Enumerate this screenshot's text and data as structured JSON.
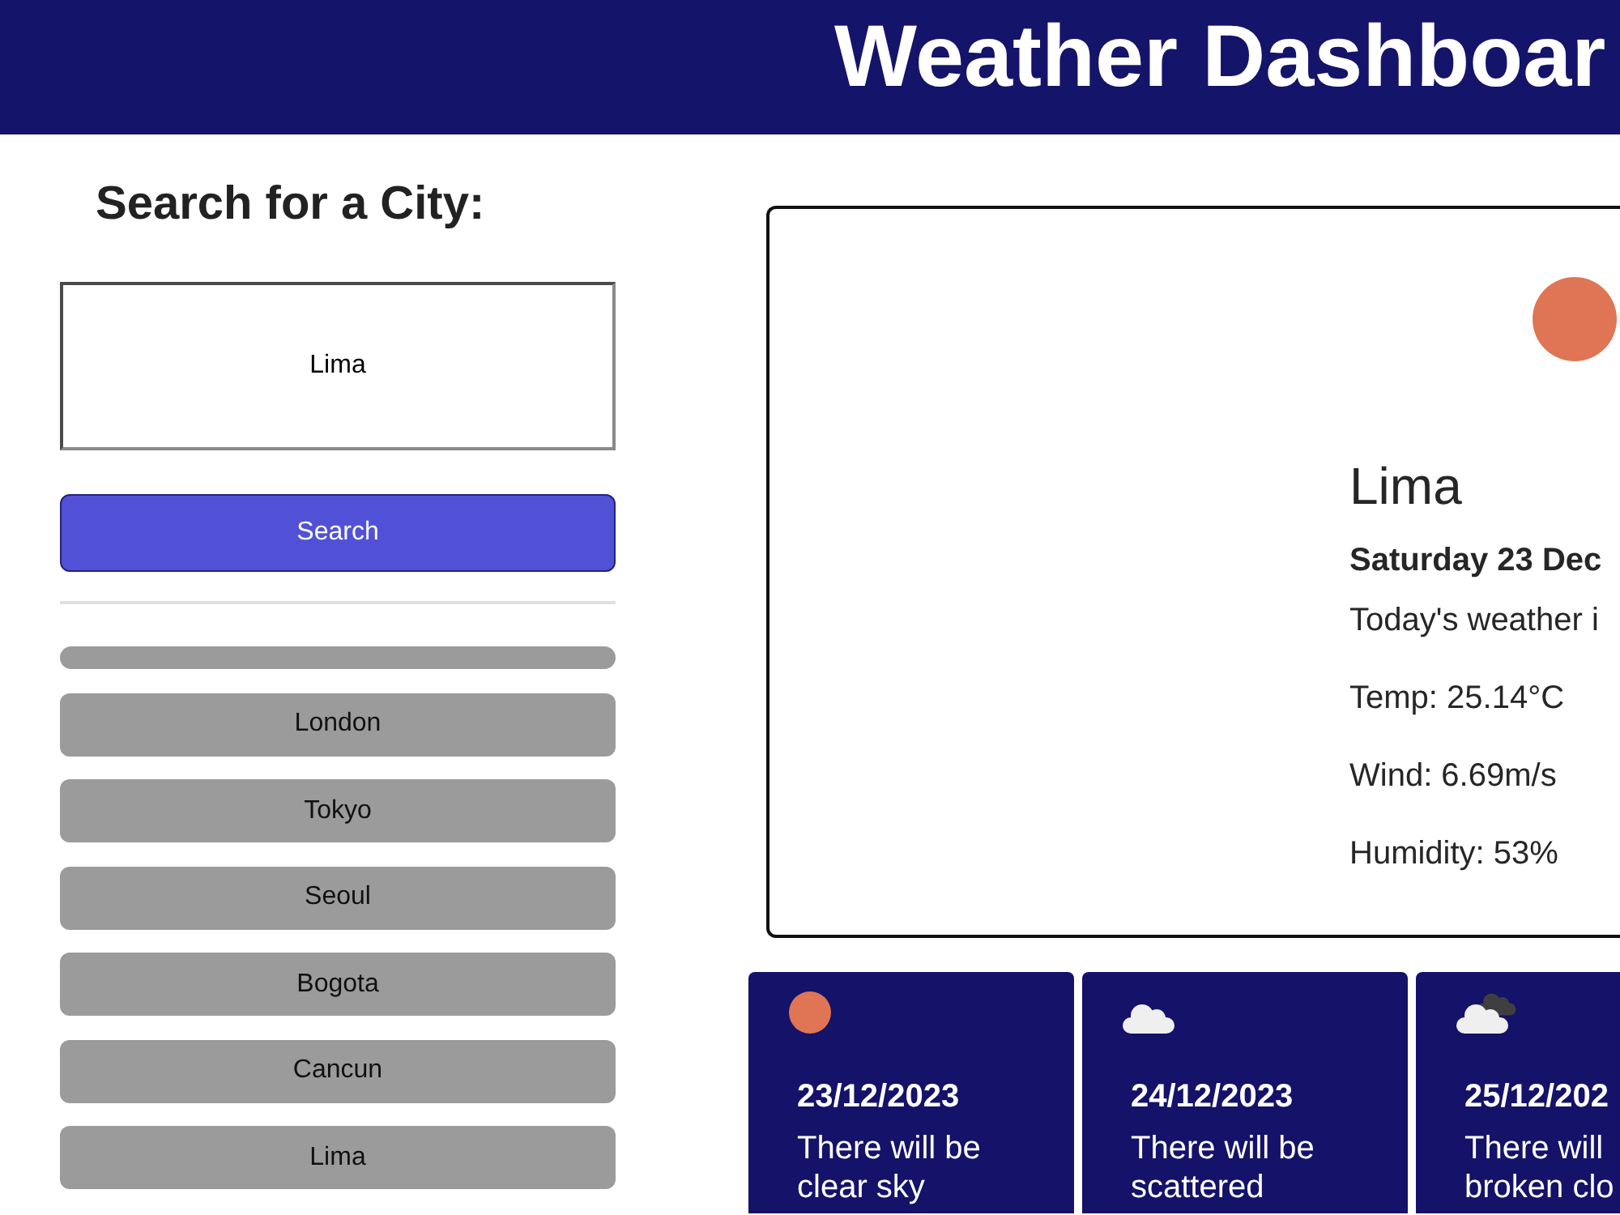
{
  "header": {
    "title": "Weather Dashboar"
  },
  "search": {
    "heading": "Search for a City:",
    "value": "Lima",
    "button": "Search"
  },
  "history": [
    {
      "kind": "empty"
    },
    {
      "kind": "city",
      "label": "London"
    },
    {
      "kind": "city",
      "label": "Tokyo"
    },
    {
      "kind": "city",
      "label": "Seoul"
    },
    {
      "kind": "city",
      "label": "Bogota"
    },
    {
      "kind": "city",
      "label": "Cancun"
    },
    {
      "kind": "city",
      "label": "Lima"
    }
  ],
  "current": {
    "kind": "clear",
    "city": "Lima",
    "date": "Saturday 23 Dec",
    "summary": "Today's weather i",
    "temp": "Temp: 25.14°C",
    "wind": "Wind: 6.69m/s",
    "humidity": "Humidity: 53%"
  },
  "forecast": [
    {
      "kind": "clear",
      "date": "23/12/2023",
      "description_lines": [
        "There will be",
        "clear sky"
      ]
    },
    {
      "kind": "scattered",
      "date": "24/12/2023",
      "description_lines": [
        "There will be",
        "scattered"
      ]
    },
    {
      "kind": "broken",
      "date": "25/12/202",
      "description_lines": [
        "There will",
        "broken clo"
      ]
    }
  ]
}
